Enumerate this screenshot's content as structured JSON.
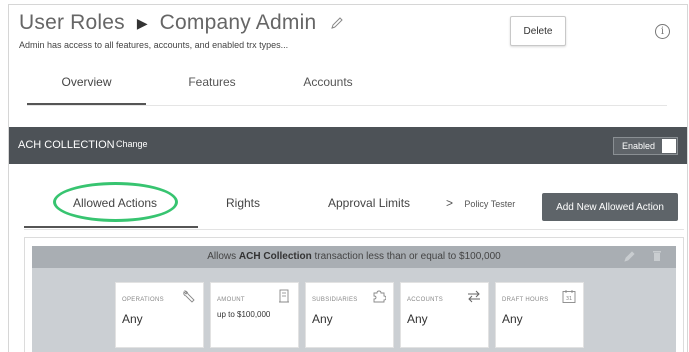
{
  "header": {
    "title_left": "User Roles",
    "title_arrow": "▶",
    "title_right": "Company Admin",
    "subtitle": "Admin has access to all features, accounts, and enabled trx types...",
    "delete_label": "Delete",
    "info_glyph": "i"
  },
  "top_tabs": [
    {
      "label": "Overview",
      "active": true
    },
    {
      "label": "Features",
      "active": false
    },
    {
      "label": "Accounts",
      "active": false
    }
  ],
  "feature_bar": {
    "label": "ACH COLLECTION",
    "change_label": "Change",
    "toggle_label": "Enabled",
    "toggle_on": true
  },
  "sub_tabs": [
    {
      "label": "Allowed Actions",
      "active": true
    },
    {
      "label": "Rights",
      "active": false
    },
    {
      "label": "Approval Limits",
      "active": false
    }
  ],
  "policy_tester": {
    "chevron": ">",
    "label": "Policy Tester"
  },
  "add_button": {
    "label": "Add New Allowed Action"
  },
  "rule": {
    "prefix": "Allows",
    "transaction_type": "ACH Collection",
    "middle": "transaction less than or equal to",
    "amount": "$100,000",
    "tiles": [
      {
        "label": "OPERATIONS",
        "value": "Any",
        "icon": "wrench-icon"
      },
      {
        "label": "AMOUNT",
        "value": "up to $100,000",
        "icon": "building-icon"
      },
      {
        "label": "SUBSIDIARIES",
        "value": "Any",
        "icon": "puzzle-icon"
      },
      {
        "label": "ACCOUNTS",
        "value": "Any",
        "icon": "transfer-arrows-icon"
      },
      {
        "label": "DRAFT HOURS",
        "value": "Any",
        "icon": "calendar-icon"
      }
    ]
  },
  "colors": {
    "dark_bar": "#4d5257",
    "highlight_ring": "#37c470",
    "rule_header": "#a9aeb3",
    "rule_body": "#cbcfd3"
  }
}
